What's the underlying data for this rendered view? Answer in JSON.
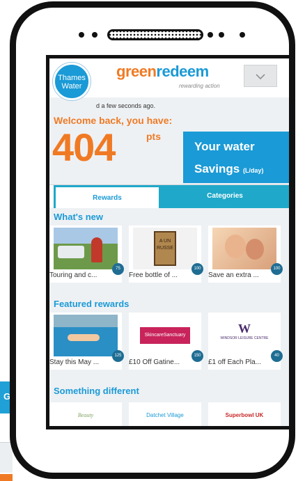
{
  "background": {
    "tab_letter": "G"
  },
  "app": {
    "logo_line1": "Thames",
    "logo_line2": "Water",
    "brand_part1": "green",
    "brand_part2": "redeem",
    "tagline": "rewarding action",
    "dropdown_icon": "chevron-down-icon"
  },
  "account": {
    "update_text": "d a few seconds ago.",
    "welcome": "Welcome back, you have:",
    "points": "404",
    "points_unit": "pts"
  },
  "savings_panel": {
    "title": "Your water",
    "subtitle": "Savings",
    "unit": "(L/day)"
  },
  "tabs": [
    {
      "label": "Rewards",
      "active": true
    },
    {
      "label": "Categories",
      "active": false
    }
  ],
  "sections": {
    "whats_new": {
      "title": "What's new",
      "items": [
        {
          "label": "Touring and c...",
          "badge": "75"
        },
        {
          "label": "Free bottle of ...",
          "badge": "100",
          "image_text": "A UN RUSSE"
        },
        {
          "label": "Save an extra ...",
          "badge": "100"
        }
      ]
    },
    "featured": {
      "title": "Featured rewards",
      "items": [
        {
          "label": "Stay this May ...",
          "badge": "125"
        },
        {
          "label": "£10 Off Gatine...",
          "badge": "150",
          "image_text": "SkincareSanctuary"
        },
        {
          "label": "£1 off Each Pla...",
          "badge": "40",
          "image_text": "WINDSOR LEISURE CENTRE"
        }
      ]
    },
    "different": {
      "title": "Something different",
      "items": [
        {
          "image_text": "Beauty"
        },
        {
          "image_text": "Datchet Village"
        },
        {
          "image_text": "Superbowl UK"
        }
      ]
    }
  },
  "colors": {
    "brand_orange": "#f07a24",
    "brand_blue": "#1a9ad6",
    "tab_teal": "#1fa8c9",
    "badge": "#1f6d93"
  }
}
